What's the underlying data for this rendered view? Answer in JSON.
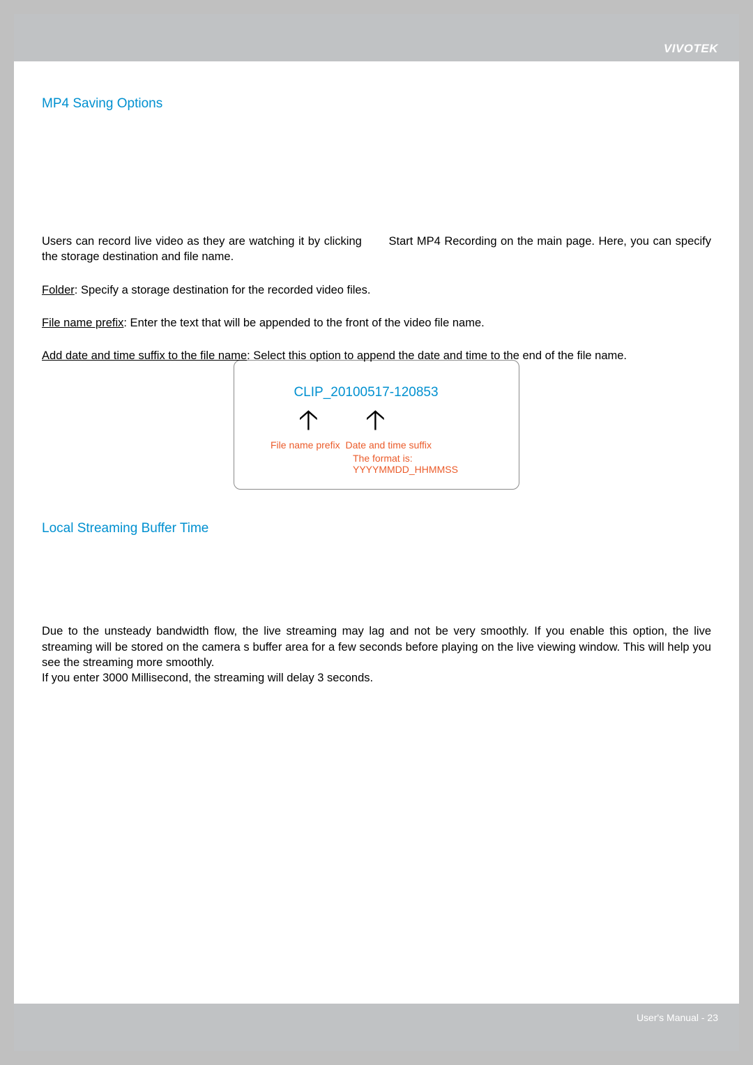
{
  "brand": "VIVOTEK",
  "section1": {
    "heading": "MP4 Saving Options",
    "intro_part1": "Users can record live video as they are watching it by clicking",
    "intro_part2": "Start MP4 Recording on the main page. Here, you can specify the storage destination and file name.",
    "folder_label": "Folder",
    "folder_text": ": Specify a storage destination for the recorded video files.",
    "prefix_label": "File name prefix",
    "prefix_text": ": Enter the text that will be appended to the front of the video file name.",
    "suffix_label": "Add date and time suffix to the file name",
    "suffix_text": ": Select this option to append the date and time to the end of the file name."
  },
  "diagram": {
    "example": "CLIP_20100517-120853",
    "label_prefix": "File name prefix",
    "label_suffix": "Date and time suffix",
    "label_format": "The format is: YYYYMMDD_HHMMSS"
  },
  "section2": {
    "heading": "Local Streaming Buffer Time",
    "para1": "Due to the unsteady bandwidth flow, the live streaming may lag and not be very smoothly. If you enable this option, the live streaming will be stored on the camera s buffer area for a few seconds before playing on the live viewing window. This will help you see the streaming more smoothly.",
    "para2": "If you enter 3000 Millisecond, the streaming will delay 3 seconds."
  },
  "footer": {
    "text": "User's Manual - 23"
  }
}
